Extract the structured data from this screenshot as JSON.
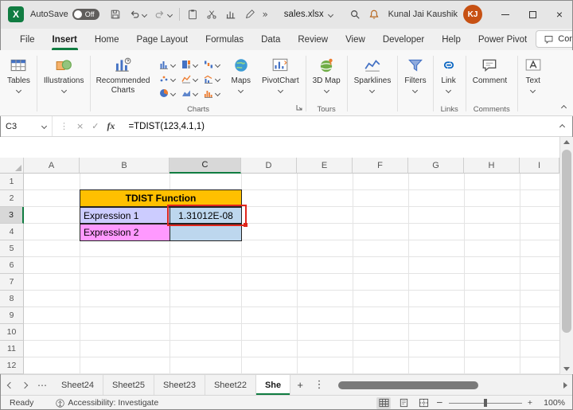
{
  "titlebar": {
    "autosave_label": "AutoSave",
    "autosave_state": "Off",
    "filename": "sales.xlsx",
    "user_name": "Kunal Jai Kaushik",
    "user_initials": "KJ"
  },
  "ribbon_tabs": {
    "items": [
      {
        "label": "File"
      },
      {
        "label": "Insert",
        "active": true
      },
      {
        "label": "Home"
      },
      {
        "label": "Page Layout"
      },
      {
        "label": "Formulas"
      },
      {
        "label": "Data"
      },
      {
        "label": "Review"
      },
      {
        "label": "View"
      },
      {
        "label": "Developer"
      },
      {
        "label": "Help"
      },
      {
        "label": "Power Pivot"
      }
    ],
    "comments_button": "Comments"
  },
  "ribbon": {
    "tables": "Tables",
    "illustrations": "Illustrations",
    "recommended_charts": "Recommended Charts",
    "maps": "Maps",
    "pivotchart": "PivotChart",
    "map_3d": "3D Map",
    "sparklines": "Sparklines",
    "filters": "Filters",
    "link": "Link",
    "comment": "Comment",
    "text": "Text",
    "group_labels": {
      "charts": "Charts",
      "tours": "Tours",
      "links": "Links",
      "comments": "Comments"
    }
  },
  "formula_bar": {
    "name_box": "C3",
    "fx_label": "fx",
    "formula": "=TDIST(123,4.1,1)"
  },
  "grid": {
    "col_headers": [
      "A",
      "B",
      "C",
      "D",
      "E",
      "F",
      "G",
      "H",
      "I"
    ],
    "row_headers": [
      "1",
      "2",
      "3",
      "4",
      "5",
      "6",
      "7",
      "8",
      "9",
      "10",
      "11",
      "12"
    ],
    "cells": {
      "b2_title": "TDIST Function",
      "b3": "Expression 1",
      "b4": "Expression 2",
      "c3": "1.31012E-08"
    },
    "active_cell": "C3"
  },
  "sheet_bar": {
    "tabs": [
      {
        "label": "Sheet24"
      },
      {
        "label": "Sheet25"
      },
      {
        "label": "Sheet23"
      },
      {
        "label": "Sheet22"
      },
      {
        "label": "She",
        "active": true
      }
    ]
  },
  "status_bar": {
    "ready": "Ready",
    "accessibility": "Accessibility: Investigate",
    "zoom": "100%"
  },
  "glyphs": {
    "logo_letter": "X",
    "more_commands": "»",
    "ellipsis_h": "⋯",
    "ellipsis_v": "⋮",
    "close": "×",
    "cancel": "×",
    "check": "✓",
    "plus": "+",
    "minus": "−"
  },
  "colors": {
    "excel_green": "#107C41",
    "title_fill": "#FFC000",
    "expr1_fill": "#CCCCFF",
    "expr2_fill": "#FF99FF",
    "result_fill": "#BDD7EE",
    "annotation_red": "#E0261C",
    "avatar_orange": "#C75113"
  }
}
